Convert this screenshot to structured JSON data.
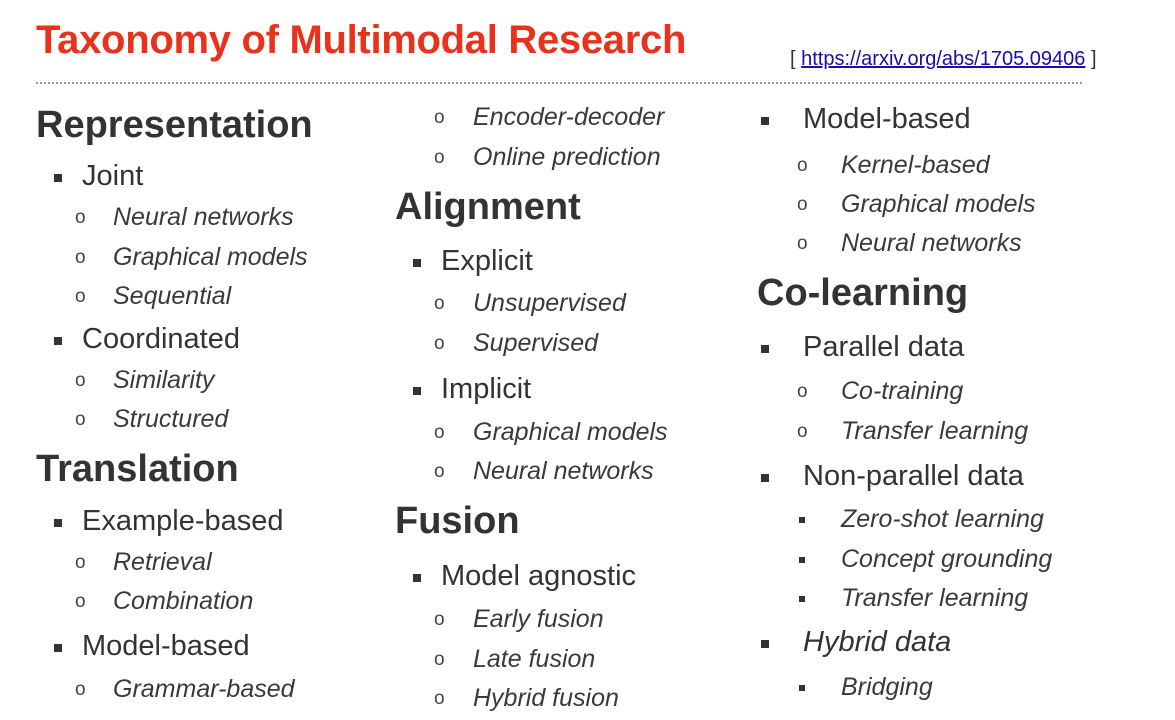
{
  "header": {
    "title": "Taxonomy of Multimodal Research",
    "ref_open": "[",
    "ref_link": "https://arxiv.org/abs/1705.09406",
    "ref_close": "]"
  },
  "colors": {
    "title": "#e8321c",
    "text": "#333333",
    "link": "#1a0dab"
  },
  "columns": [
    {
      "items": [
        {
          "level": "h",
          "text": "Representation"
        },
        {
          "level": 1,
          "text": "Joint"
        },
        {
          "level": 2,
          "text": "Neural networks",
          "marker": "o"
        },
        {
          "level": 2,
          "text": "Graphical models",
          "marker": "o"
        },
        {
          "level": 2,
          "text": "Sequential",
          "marker": "o"
        },
        {
          "level": 1,
          "text": "Coordinated"
        },
        {
          "level": 2,
          "text": "Similarity",
          "marker": "o"
        },
        {
          "level": 2,
          "text": "Structured",
          "marker": "o"
        },
        {
          "level": "h",
          "text": "Translation"
        },
        {
          "level": 1,
          "text": "Example-based"
        },
        {
          "level": 2,
          "text": "Retrieval",
          "marker": "o"
        },
        {
          "level": 2,
          "text": "Combination",
          "marker": "o"
        },
        {
          "level": 1,
          "text": "Model-based"
        },
        {
          "level": 2,
          "text": "Grammar-based",
          "marker": "o"
        }
      ]
    },
    {
      "items": [
        {
          "level": 2,
          "text": "Encoder-decoder",
          "marker": "o"
        },
        {
          "level": 2,
          "text": "Online prediction",
          "marker": "o"
        },
        {
          "level": "h",
          "text": "Alignment"
        },
        {
          "level": 1,
          "text": "Explicit"
        },
        {
          "level": 2,
          "text": "Unsupervised",
          "marker": "o"
        },
        {
          "level": 2,
          "text": "Supervised",
          "marker": "o"
        },
        {
          "level": 1,
          "text": "Implicit"
        },
        {
          "level": 2,
          "text": "Graphical models",
          "marker": "o"
        },
        {
          "level": 2,
          "text": "Neural networks",
          "marker": "o"
        },
        {
          "level": "h",
          "text": "Fusion"
        },
        {
          "level": 1,
          "text": "Model agnostic"
        },
        {
          "level": 2,
          "text": "Early fusion",
          "marker": "o"
        },
        {
          "level": 2,
          "text": "Late fusion",
          "marker": "o"
        },
        {
          "level": 2,
          "text": "Hybrid fusion",
          "marker": "o"
        }
      ]
    },
    {
      "items": [
        {
          "level": 1,
          "text": "Model-based"
        },
        {
          "level": 2,
          "text": "Kernel-based",
          "marker": "o"
        },
        {
          "level": 2,
          "text": "Graphical models",
          "marker": "o"
        },
        {
          "level": 2,
          "text": "Neural networks",
          "marker": "o"
        },
        {
          "level": "h",
          "text": "Co-learning"
        },
        {
          "level": 1,
          "text": "Parallel data"
        },
        {
          "level": 2,
          "text": "Co-training",
          "marker": "o"
        },
        {
          "level": 2,
          "text": "Transfer learning",
          "marker": "o"
        },
        {
          "level": 1,
          "text": "Non-parallel data"
        },
        {
          "level": 2,
          "text": "Zero-shot learning",
          "marker": "square"
        },
        {
          "level": 2,
          "text": "Concept grounding",
          "marker": "square"
        },
        {
          "level": 2,
          "text": "Transfer learning",
          "marker": "square"
        },
        {
          "level": 1,
          "text": "Hybrid data",
          "italic": true
        },
        {
          "level": 2,
          "text": "Bridging",
          "marker": "square"
        }
      ]
    }
  ]
}
